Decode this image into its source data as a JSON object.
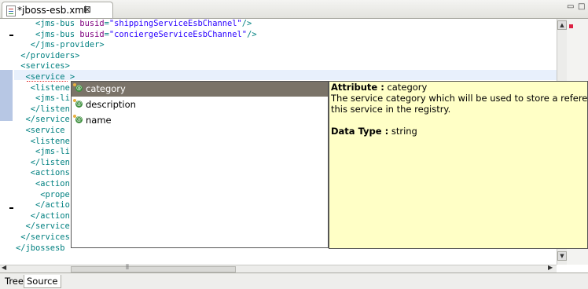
{
  "tab": {
    "title": "*jboss-esb.xml",
    "close": "⊠"
  },
  "window_controls": {
    "minimize": "▭",
    "maximize": "□"
  },
  "code_lines": [
    {
      "pre": "    ",
      "open": "<jms-bus ",
      "attr": "busid",
      "eq": "=",
      "val": "\"shippingServiceEsbChannel\"",
      "close": "/>"
    },
    {
      "pre": "    ",
      "open": "<jms-bus ",
      "attr": "busid",
      "eq": "=",
      "val": "\"conciergeServiceEsbChannel\"",
      "close": "/>"
    },
    {
      "pre": "   ",
      "open": "</jms-provider>",
      "attr": "",
      "eq": "",
      "val": "",
      "close": ""
    },
    {
      "pre": " ",
      "open": "</providers>",
      "attr": "",
      "eq": "",
      "val": "",
      "close": ""
    },
    {
      "pre": " ",
      "open": "<services>",
      "attr": "",
      "eq": "",
      "val": "",
      "close": ""
    },
    {
      "pre": "  ",
      "open": "<service >",
      "attr": "",
      "eq": "",
      "val": "",
      "close": ""
    },
    {
      "pre": "   ",
      "open": "<listene",
      "attr": "",
      "eq": "",
      "val": "",
      "close": ""
    },
    {
      "pre": "    ",
      "open": "<jms-li",
      "attr": "",
      "eq": "",
      "val": "",
      "close": ""
    },
    {
      "pre": "   ",
      "open": "</listen",
      "attr": "",
      "eq": "",
      "val": "",
      "close": ""
    },
    {
      "pre": "  ",
      "open": "</service",
      "attr": "",
      "eq": "",
      "val": "",
      "close": ""
    },
    {
      "pre": "  ",
      "open": "<service",
      "attr": "",
      "eq": "",
      "val": "",
      "close": ""
    },
    {
      "pre": "   ",
      "open": "<listene",
      "attr": "",
      "eq": "",
      "val": "",
      "close": ""
    },
    {
      "pre": "    ",
      "open": "<jms-li",
      "attr": "",
      "eq": "",
      "val": "",
      "close": ""
    },
    {
      "pre": "   ",
      "open": "</listen",
      "attr": "",
      "eq": "",
      "val": "",
      "close": ""
    },
    {
      "pre": "   ",
      "open": "<actions",
      "attr": "",
      "eq": "",
      "val": "",
      "close": ""
    },
    {
      "pre": "    ",
      "open": "<action",
      "attr": "",
      "eq": "",
      "val": "",
      "close": ""
    },
    {
      "pre": "     ",
      "open": "<prope",
      "attr": "",
      "eq": "",
      "val": "",
      "close": ""
    },
    {
      "pre": "    ",
      "open": "</actio",
      "attr": "",
      "eq": "",
      "val": "",
      "close": ""
    },
    {
      "pre": "   ",
      "open": "</action",
      "attr": "",
      "eq": "",
      "val": "",
      "close": ""
    },
    {
      "pre": "  ",
      "open": "</service",
      "attr": "",
      "eq": "",
      "val": "",
      "close": ""
    },
    {
      "pre": " ",
      "open": "</services",
      "attr": "",
      "eq": "",
      "val": "",
      "close": ""
    },
    {
      "pre": "",
      "open": "</jbossesb",
      "attr": "",
      "eq": "",
      "val": "",
      "close": ""
    }
  ],
  "autocomplete": {
    "items": [
      {
        "label": "category",
        "icon": "attribute-icon",
        "selected": true
      },
      {
        "label": "description",
        "icon": "attribute-icon",
        "selected": false
      },
      {
        "label": "name",
        "icon": "attribute-icon",
        "selected": false
      }
    ]
  },
  "info": {
    "attribute_label": "Attribute :",
    "attribute_value": "category",
    "description_1": "The service category which will be used to store a reference to",
    "description_2": " this service in the registry.",
    "datatype_label": "Data Type :",
    "datatype_value": "string"
  },
  "bottom_tabs": [
    "Tree",
    "Source"
  ],
  "scroll": {
    "up": "▲",
    "down": "▼",
    "left": "◀",
    "right": "▶",
    "grip": "⦀"
  },
  "colors": {
    "tag": "#008080",
    "attr_name": "#7f007f",
    "attr_value": "#2a00ff",
    "tooltip_bg": "#ffffc6",
    "selection": "#7a7368"
  }
}
